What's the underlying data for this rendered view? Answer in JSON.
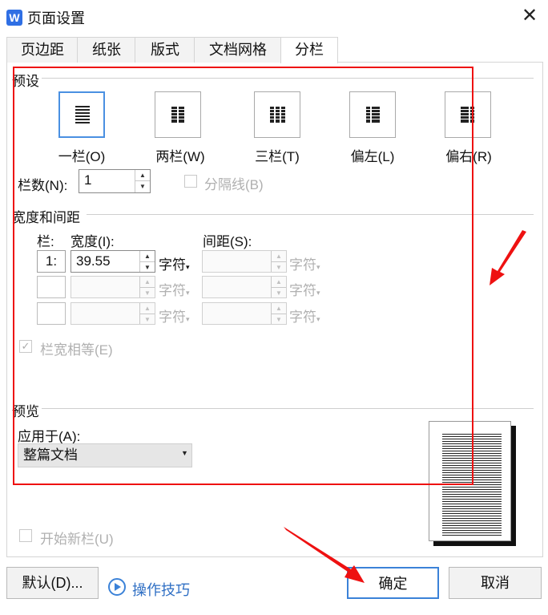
{
  "window": {
    "title": "页面设置",
    "app_icon": "W"
  },
  "tabs": [
    {
      "label": "页边距"
    },
    {
      "label": "纸张"
    },
    {
      "label": "版式"
    },
    {
      "label": "文档网格"
    },
    {
      "label": "分栏"
    }
  ],
  "presets": {
    "group_label": "预设",
    "items": [
      {
        "label": "一栏(O)",
        "icon": "one-column-icon"
      },
      {
        "label": "两栏(W)",
        "icon": "two-columns-icon"
      },
      {
        "label": "三栏(T)",
        "icon": "three-columns-icon"
      },
      {
        "label": "偏左(L)",
        "icon": "left-column-icon"
      },
      {
        "label": "偏右(R)",
        "icon": "right-column-icon"
      }
    ]
  },
  "columns_count": {
    "label": "栏数(N):",
    "value": "1"
  },
  "separator": {
    "label": "分隔线(B)"
  },
  "width_spacing": {
    "group_label": "宽度和间距",
    "col_header": "栏:",
    "width_header": "宽度(I):",
    "spacing_header": "间距(S):",
    "unit": "字符",
    "rows": [
      {
        "col": "1:",
        "width": "39.55",
        "spacing": ""
      },
      {
        "col": "",
        "width": "",
        "spacing": ""
      },
      {
        "col": "",
        "width": "",
        "spacing": ""
      }
    ],
    "equal_width": {
      "label": "栏宽相等(E)",
      "checked": true
    }
  },
  "preview": {
    "group_label": "预览",
    "apply_label": "应用于(A):",
    "apply_value": "整篇文档"
  },
  "new_column": {
    "label": "开始新栏(U)"
  },
  "buttons": {
    "default": "默认(D)...",
    "tips": "操作技巧",
    "ok": "确定",
    "cancel": "取消"
  },
  "colors": {
    "accent": "#3b82d8",
    "annotation": "#ee1111"
  }
}
